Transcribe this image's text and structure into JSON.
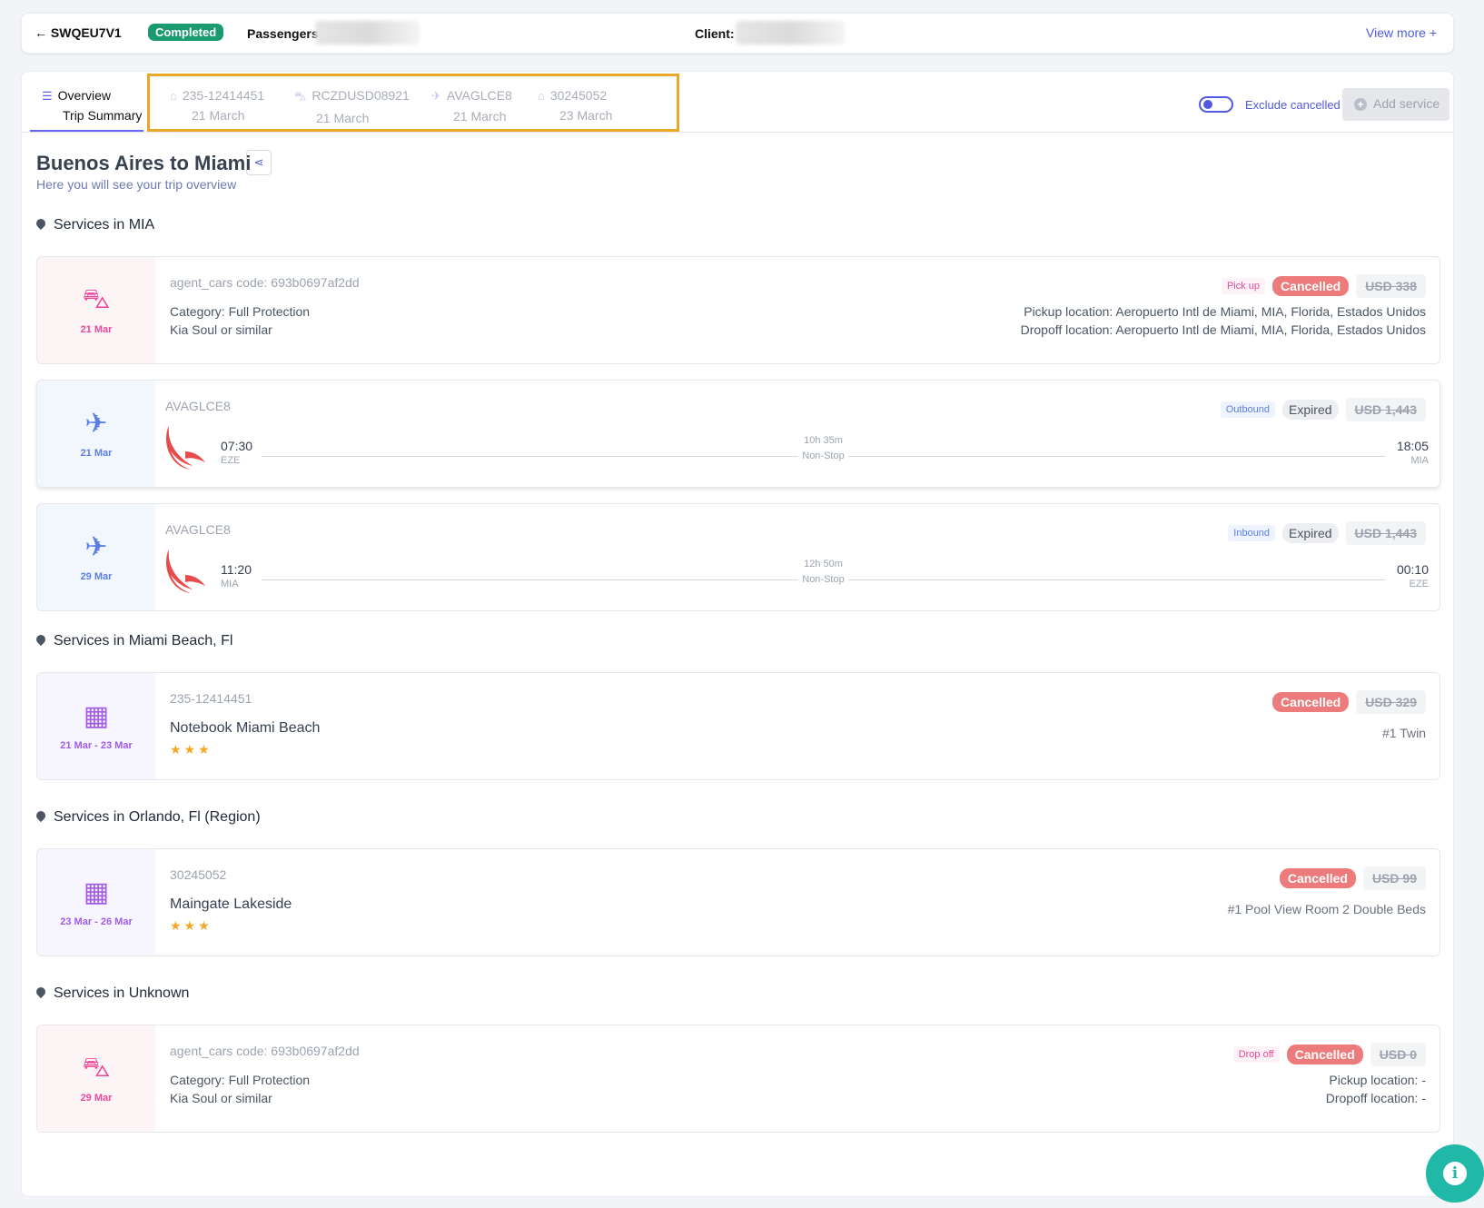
{
  "header": {
    "back_label": "← SWQEU7V1",
    "status": "Completed",
    "passengers_label": "Passengers:",
    "client_label": "Client:",
    "view_more": "View more +"
  },
  "tabs": {
    "overview": "Overview",
    "trip_summary": "Trip Summary",
    "services": [
      {
        "code": "235-12414451",
        "date": "21 March",
        "icon": "hotel-icon"
      },
      {
        "code": "RCZDUSD08921",
        "date": "21 March",
        "icon": "car-icon"
      },
      {
        "code": "AVAGLCE8",
        "date": "21 March",
        "icon": "flight-icon"
      },
      {
        "code": "30245052",
        "date": "23 March",
        "icon": "hotel-icon"
      }
    ],
    "exclude_cancelled": "Exclude cancelled",
    "add_service": "Add service"
  },
  "trip": {
    "title": "Buenos Aires to Miami",
    "subtitle": "Here you will see your trip overview"
  },
  "sections": {
    "mia": "Services in MIA",
    "miami_beach": "Services in Miami Beach, Fl",
    "orlando": "Services in Orlando, Fl (Region)",
    "unknown": "Services in Unknown"
  },
  "car1": {
    "date": "21 Mar",
    "code": "agent_cars code: 693b0697af2dd",
    "category": "Category: Full Protection",
    "model": "Kia Soul or similar",
    "tag": "Pick up",
    "status": "Cancelled",
    "price": "USD 338",
    "pickup": "Pickup location: Aeropuerto Intl de Miami, MIA, Florida, Estados Unidos",
    "dropoff": "Dropoff location: Aeropuerto Intl de Miami, MIA, Florida, Estados Unidos"
  },
  "flight1": {
    "date": "21 Mar",
    "code": "AVAGLCE8",
    "tag": "Outbound",
    "status": "Expired",
    "price": "USD 1,443",
    "dep_time": "07:30",
    "dep_city": "EZE",
    "duration": "10h 35m",
    "stops": "Non-Stop",
    "arr_time": "18:05",
    "arr_city": "MIA"
  },
  "flight2": {
    "date": "29 Mar",
    "code": "AVAGLCE8",
    "tag": "Inbound",
    "status": "Expired",
    "price": "USD 1,443",
    "dep_time": "11:20",
    "dep_city": "MIA",
    "duration": "12h 50m",
    "stops": "Non-Stop",
    "arr_time": "00:10",
    "arr_city": "EZE"
  },
  "hotel1": {
    "date": "21 Mar - 23 Mar",
    "code": "235-12414451",
    "name": "Notebook Miami Beach",
    "stars": "★★★",
    "status": "Cancelled",
    "price": "USD 329",
    "room": "#1 Twin"
  },
  "hotel2": {
    "date": "23 Mar - 26 Mar",
    "code": "30245052",
    "name": "Maingate Lakeside",
    "stars": "★★★",
    "status": "Cancelled",
    "price": "USD 99",
    "room": "#1 Pool View Room 2 Double Beds"
  },
  "car2": {
    "date": "29 Mar",
    "code": "agent_cars code: 693b0697af2dd",
    "category": "Category: Full Protection",
    "model": "Kia Soul or similar",
    "tag": "Drop off",
    "status": "Cancelled",
    "price": "USD 0",
    "pickup": "Pickup location: -",
    "dropoff": "Dropoff location: -"
  },
  "colors": {
    "accent": "#4f5ae0",
    "completed": "#1a9b6e",
    "cancelled": "#ee7b7b",
    "highlight_border": "#e8a92b",
    "fab": "#20b9a8"
  }
}
